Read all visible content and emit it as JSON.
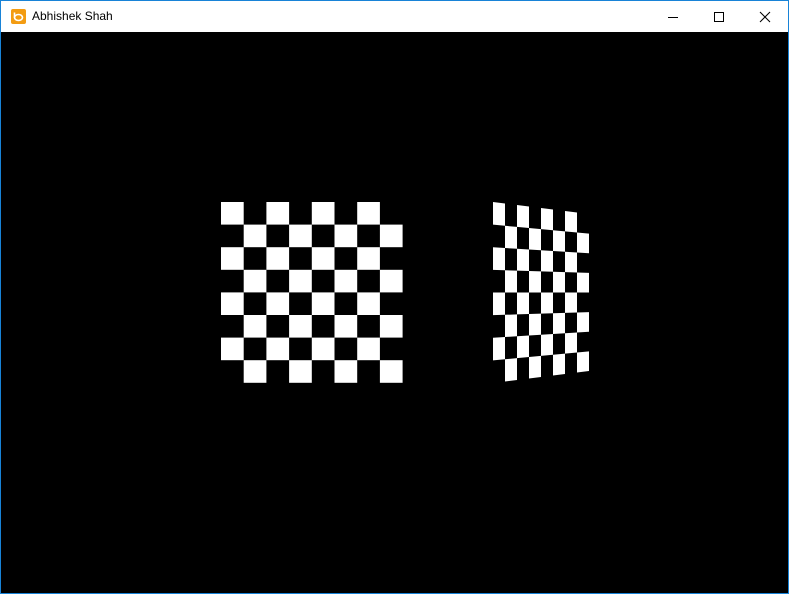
{
  "window": {
    "title": "Abhishek Shah",
    "accent_color": "#1883d7",
    "icon": "app-icon"
  },
  "caption_buttons": {
    "minimize_icon": "minimize-icon",
    "maximize_icon": "maximize-icon",
    "close_icon": "close-icon"
  },
  "scene": {
    "background_color": "#000000",
    "board_color": "#ffffff",
    "boards": [
      {
        "name": "front-facing",
        "rows": 8,
        "cols": 8
      },
      {
        "name": "rotated",
        "rows": 8,
        "cols": 8
      }
    ]
  }
}
